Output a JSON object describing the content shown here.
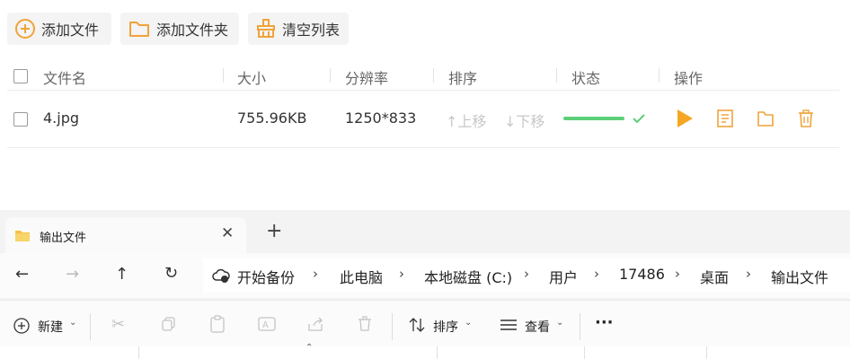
{
  "toolbar": {
    "add_file": "添加文件",
    "add_folder": "添加文件夹",
    "clear_list": "清空列表"
  },
  "table": {
    "headers": {
      "name": "文件名",
      "size": "大小",
      "resolution": "分辨率",
      "sort": "排序",
      "status": "状态",
      "actions": "操作"
    },
    "rows": [
      {
        "name": "4.jpg",
        "size": "755.96KB",
        "resolution": "1250*833",
        "move_up": "↑上移",
        "move_down": "↓下移",
        "progress": 1.0
      }
    ]
  },
  "explorer": {
    "tab_title": "输出文件",
    "breadcrumb": [
      "开始备份",
      "此电脑",
      "本地磁盘 (C:)",
      "用户",
      "17486",
      "桌面",
      "输出文件"
    ],
    "commands": {
      "new": "新建",
      "sort": "排序",
      "view": "查看",
      "more": "···"
    }
  },
  "colors": {
    "accent_orange": "#f0a33a",
    "progress_green": "#5ccf78"
  }
}
